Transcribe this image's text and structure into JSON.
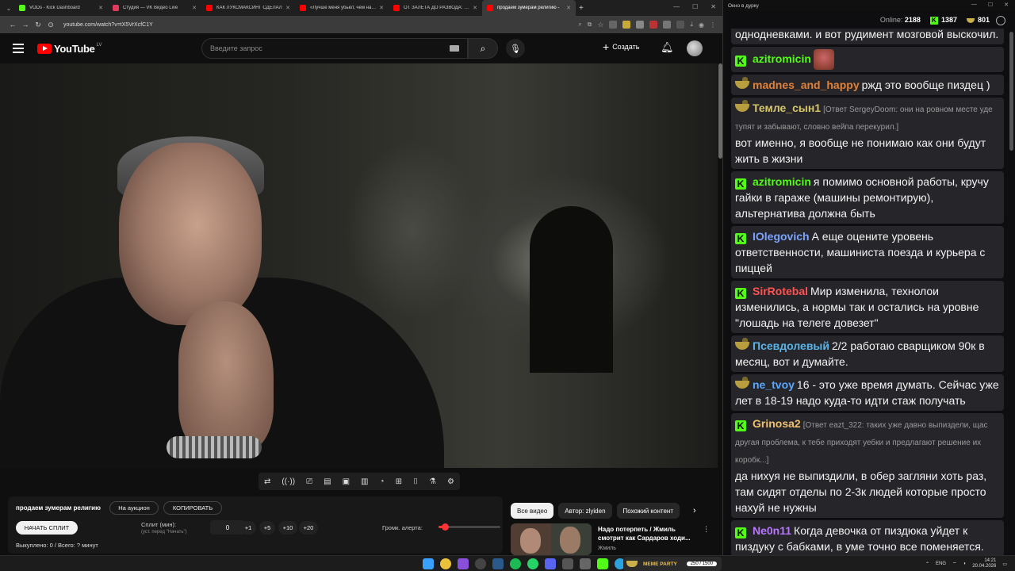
{
  "browser": {
    "tabs": [
      {
        "title": "VODs - Kick Dashboard",
        "color": "#53fc18",
        "active": false
      },
      {
        "title": "Студия — VK Видео Live",
        "color": "#e03b5a",
        "active": false
      },
      {
        "title": "КАК ЛУКСМАКСИНГ СДЕЛАЛ",
        "color": "#ff0000",
        "active": false
      },
      {
        "title": "«Лучше меня убьют, чем на на",
        "color": "#ff0000",
        "active": false
      },
      {
        "title": "ОТ ЗАЛЕТА ДО РАЗВОДА: поч",
        "color": "#ff0000",
        "active": false
      },
      {
        "title": "продаем зумерам религию -",
        "color": "#ff0000",
        "active": true
      }
    ],
    "new_tab": "+",
    "url": "youtube.com/watch?v=tX5VrXcfC1Y"
  },
  "youtube": {
    "logo_text": "YouTube",
    "country_code": "LV",
    "search_placeholder": "Введите запрос",
    "create_label": "Создать"
  },
  "extension": {
    "video_title": "продаем зумерам религию",
    "auction_label": "На аукцион",
    "copy_label": "КОПИРОВАТЬ",
    "start_split_label": "НАЧАТЬ СПЛИТ",
    "split_label": "Сплит (мин):",
    "split_hint": "(уст. перед \"Начать\")",
    "split_value": "0",
    "inc_buttons": [
      "+1",
      "+5",
      "+10",
      "+20"
    ],
    "volume_label": "Громк. алерта:",
    "volume_fraction": 0.1,
    "status": "Выкуплено: 0 / Всего: ? минут"
  },
  "related": {
    "chips": [
      "Все видео",
      "Автор: zlyiden",
      "Похожий контент"
    ],
    "video": {
      "title": "Надо потерпеть / Жмиль смотрит как Сардаров ходи...",
      "channel": "Жмиль"
    }
  },
  "chat_window": {
    "title": "Окно в дурку",
    "online_label": "Online:",
    "online": "2188",
    "kick_count": "1387",
    "vk_count": "801",
    "messages": [
      {
        "user": "",
        "color": "#ffffff",
        "badge": "none",
        "reply": "",
        "text": "однодневками. и вот рудимент мозговой выскочил."
      },
      {
        "user": "azitromicin",
        "color": "#53fc18",
        "badge": "k",
        "reply": "",
        "text": "",
        "emote": true
      },
      {
        "user": "madnes_and_happy",
        "color": "#e0813a",
        "badge": "b",
        "reply": "",
        "text": "ржд это вообще пиздец )"
      },
      {
        "user": "Темле_сын1",
        "color": "#d6c66b",
        "badge": "b",
        "reply": "[Ответ SergeyDoom: они на ровном месте уде тупят и забывают, словно вейпа перекурил.]",
        "text": "вот именно, я вообще не понимаю как они будут жить в жизни"
      },
      {
        "user": "azitromicin",
        "color": "#53fc18",
        "badge": "k",
        "reply": "",
        "text": "я помимо основной работы, кручу гайки в гараже (машины ремонтирую), альтернатива должна быть"
      },
      {
        "user": "IOlegovich",
        "color": "#7aa4ff",
        "badge": "k",
        "reply": "",
        "text": "А еще оцените уровень ответственности, машиниста поезда и курьера с пиццей"
      },
      {
        "user": "SirRotebal",
        "color": "#ff5252",
        "badge": "k",
        "reply": "",
        "text": "Мир изменила, технолои изменились, а нормы так и остались на уровне \"лошадь на телеге довезет\""
      },
      {
        "user": "Псевдолевый",
        "color": "#5ab4e8",
        "badge": "b",
        "reply": "",
        "text": "2/2 работаю сварщиком 90к в месяц, вот и думайте."
      },
      {
        "user": "ne_tvoy",
        "color": "#5aa7ff",
        "badge": "b",
        "reply": "",
        "text": "16 - это уже время думать. Сейчас уже лет в 18-19 надо куда-то идти стаж получать"
      },
      {
        "user": "Grinosa2",
        "color": "#f0c070",
        "badge": "k",
        "reply": "[Ответ eazt_322: таких уже давно выпиздели, щас другая проблема, к тебе приходят уебки и предлагают решение их коробк...]",
        "text": "да нихуя не выпиздили, в обер загляни хоть раз, там сидят отделы по 2-3к людей которые просто нахуй не нужны"
      },
      {
        "user": "Ne0n11",
        "color": "#b777ff",
        "badge": "k",
        "reply": "",
        "text": "Когда девочка от пиздюка уйдет к пиздуку с бабками, в уме точно все поменяется."
      }
    ]
  },
  "taskbar": {
    "widget_label": "MEME PARTY",
    "widget_count": "250 / 1500",
    "lang": "ENG",
    "time": "14:21",
    "date": "20.04.2026"
  }
}
